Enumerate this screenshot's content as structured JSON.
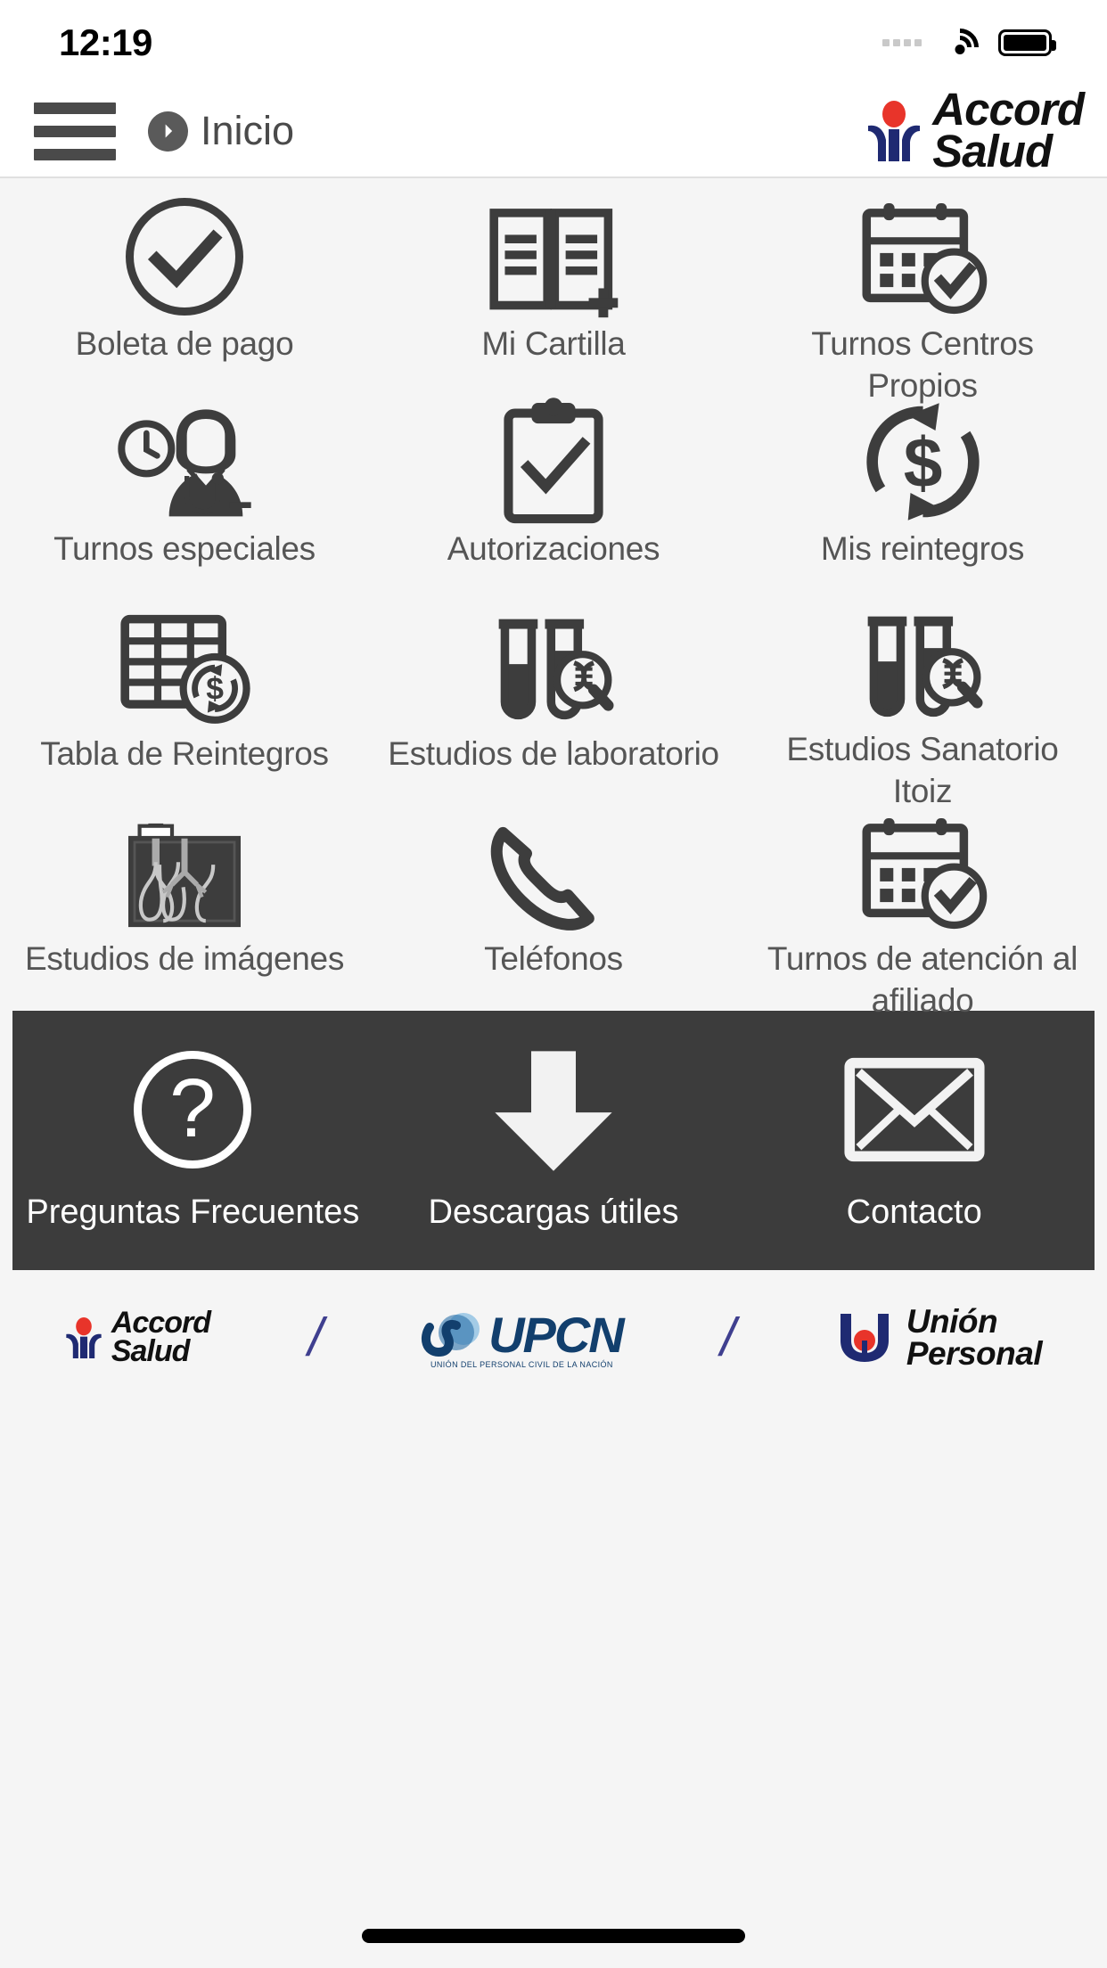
{
  "status_bar": {
    "time": "12:19",
    "wifi_icon": "wifi-icon",
    "battery_icon": "battery-full-icon",
    "signal_icon": "signal-dots-icon"
  },
  "header": {
    "menu_icon": "hamburger-menu-icon",
    "breadcrumb_icon": "chevron-right-circle-icon",
    "breadcrumb_label": "Inicio",
    "brand": {
      "line1": "Accord",
      "line2": "Salud",
      "mark_icon": "accord-person-logo-icon",
      "red": "#e8342a",
      "blue": "#1f2a72"
    }
  },
  "menu_grid": {
    "rows": [
      [
        {
          "label": "Boleta de pago",
          "icon": "check-circle-icon"
        },
        {
          "label": "Mi Cartilla",
          "icon": "open-book-plus-icon"
        },
        {
          "label": "Turnos Centros Propios",
          "icon": "calendar-check-icon"
        }
      ],
      [
        {
          "label": "Turnos especiales",
          "icon": "doctor-clock-icon"
        },
        {
          "label": "Autorizaciones",
          "icon": "clipboard-check-icon"
        },
        {
          "label": "Mis reintegros",
          "icon": "dollar-refresh-icon"
        }
      ],
      [
        {
          "label": "Tabla de Reintegros",
          "icon": "table-dollar-icon"
        },
        {
          "label": "Estudios de laboratorio",
          "icon": "test-tubes-dna-icon"
        },
        {
          "label": "Estudios Sanatorio Itoiz",
          "icon": "test-tubes-dna-icon"
        }
      ],
      [
        {
          "label": "Estudios de imágenes",
          "icon": "xray-lungs-icon"
        },
        {
          "label": "Teléfonos",
          "icon": "phone-handset-icon"
        },
        {
          "label": "Turnos de atención al afiliado",
          "icon": "calendar-check-icon"
        }
      ]
    ]
  },
  "dark_panel": {
    "background": "#3c3c3c",
    "items": [
      {
        "label": "Preguntas Frecuentes",
        "icon": "question-circle-icon"
      },
      {
        "label": "Descargas útiles",
        "icon": "download-arrow-icon"
      },
      {
        "label": "Contacto",
        "icon": "envelope-icon"
      }
    ]
  },
  "footer": {
    "separator": "/",
    "logos": [
      {
        "name": "accord-salud-logo",
        "line1": "Accord",
        "line2": "Salud"
      },
      {
        "name": "upcn-logo",
        "text": "UPCN",
        "subtext": "UNIÓN DEL PERSONAL CIVIL DE LA NACIÓN"
      },
      {
        "name": "union-personal-logo",
        "line1": "Unión",
        "line2": "Personal"
      }
    ]
  },
  "home_indicator": "home-indicator-bar"
}
